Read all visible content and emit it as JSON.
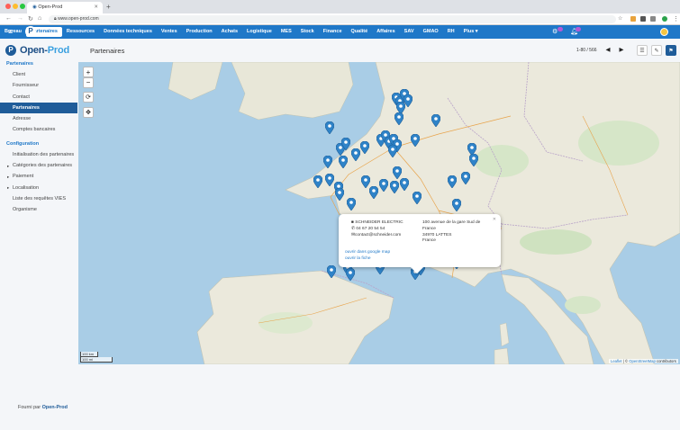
{
  "browser": {
    "tab_title": "Open-Prod",
    "url": "www.open-prod.com"
  },
  "navbar": {
    "menu": [
      "Bureau",
      "Partenaires",
      "Ressources",
      "Données techniques",
      "Ventes",
      "Production",
      "Achats",
      "Logistique",
      "MES",
      "Stock",
      "Finance",
      "Qualité",
      "Affaires",
      "SAV",
      "GMAO",
      "RH",
      "Plus"
    ],
    "active": "Partenaires",
    "messages_badge": "",
    "notifications_badge": ""
  },
  "app": {
    "logo_main": "Open-",
    "logo_accent": "Prod",
    "page_title": "Partenaires",
    "pager": "1-80 / 566"
  },
  "sidebar": {
    "section1": "Partenaires",
    "items1": [
      "Client",
      "Fournisseur",
      "Contact",
      "Partenaires",
      "Adresse",
      "Comptes bancaires"
    ],
    "active": "Partenaires",
    "section2": "Configuration",
    "items2": [
      {
        "label": "Initialisation des partenaires",
        "caret": false
      },
      {
        "label": "Catégories des partenaires",
        "caret": true
      },
      {
        "label": "Paiement",
        "caret": true
      },
      {
        "label": "Localisation",
        "caret": true
      },
      {
        "label": "Liste des requêtes VIES",
        "caret": false
      },
      {
        "label": "Organisme",
        "caret": false
      }
    ]
  },
  "map": {
    "popup": {
      "name": "SCHNEIDER ELECTRIC",
      "phone": "04 67 20 54 54",
      "email": "contact@schneider.com",
      "address1": "100 avenue de la gare Sud de",
      "address2": "France",
      "address3": "34970 LATTES",
      "address4": "France",
      "link1": "ouvrir dans google map",
      "link2": "ouvrir la fiche"
    },
    "scale_km": "100 km",
    "scale_mi": "100 mi",
    "attribution_leaflet": "Leaflet",
    "attribution_sep": " | © ",
    "attribution_osm": "OpenStreetMap",
    "attribution_tail": " contributors",
    "marker_color": "#2f83c8"
  },
  "footer": {
    "prefix": "Fourni par ",
    "brand": "Open-Prod"
  }
}
